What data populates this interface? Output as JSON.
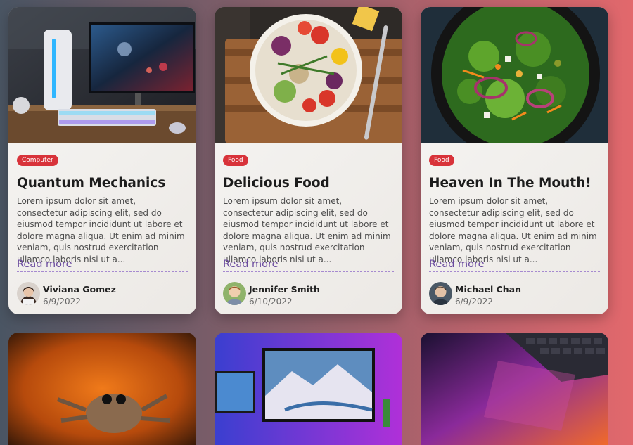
{
  "cards": [
    {
      "tag": "Computer",
      "title": "Quantum Mechanics",
      "description": "Lorem ipsum dolor sit amet, consectetur adipiscing elit, sed do eiusmod tempor incididunt ut labore et dolore magna aliqua. Ut enim ad minim veniam, quis nostrud exercitation ullamco laboris nisi ut a...",
      "read_more": "Read more",
      "author": "Viviana Gomez",
      "date": "6/9/2022"
    },
    {
      "tag": "Food",
      "title": "Delicious Food",
      "description": "Lorem ipsum dolor sit amet, consectetur adipiscing elit, sed do eiusmod tempor incididunt ut labore et dolore magna aliqua. Ut enim ad minim veniam, quis nostrud exercitation ullamco laboris nisi ut a...",
      "read_more": "Read more",
      "author": "Jennifer Smith",
      "date": "6/10/2022"
    },
    {
      "tag": "Food",
      "title": "Heaven In The Mouth!",
      "description": "Lorem ipsum dolor sit amet, consectetur adipiscing elit, sed do eiusmod tempor incididunt ut labore et dolore magna aliqua. Ut enim ad minim veniam, quis nostrud exercitation ullamco laboris nisi ut a...",
      "read_more": "Read more",
      "author": "Michael Chan",
      "date": "6/9/2022"
    }
  ],
  "colors": {
    "tag_bg": "#d8333a",
    "read_more": "#6a4b9e"
  }
}
